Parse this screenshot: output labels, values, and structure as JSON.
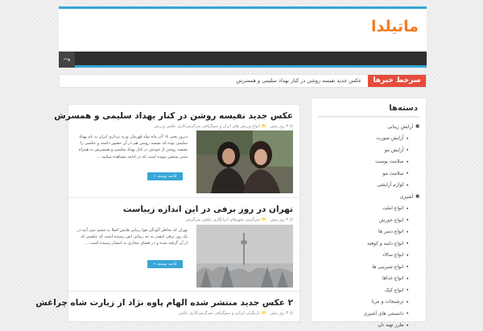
{
  "header": {
    "logo_main": "ماتیلدا",
    "shuffle_icon": "shuffle-icon"
  },
  "breaking": {
    "label": "سرخط خبرها",
    "text": "عکس جدید نفیسه روشن در کنار بهداد سلیمی و همسرش"
  },
  "sidebar": {
    "title": "دسته‌ها",
    "items": [
      {
        "label": "آرایش زیبایی",
        "sub": false
      },
      {
        "label": "آرایش صورت",
        "sub": true
      },
      {
        "label": "آرایش مو",
        "sub": true
      },
      {
        "label": "سلامت پوست",
        "sub": true
      },
      {
        "label": "سلامت مو",
        "sub": true
      },
      {
        "label": "لوازم آرایشی",
        "sub": true
      },
      {
        "label": "آشپزی",
        "sub": false
      },
      {
        "label": "انواع املت",
        "sub": true
      },
      {
        "label": "انواع خورش",
        "sub": true
      },
      {
        "label": "انواع دسر ها",
        "sub": true
      },
      {
        "label": "انواع دلمه و کوفته",
        "sub": true
      },
      {
        "label": "انواع سالاد",
        "sub": true
      },
      {
        "label": "انواع شیرینی ها",
        "sub": true
      },
      {
        "label": "انواع غذاها",
        "sub": true
      },
      {
        "label": "انواع کیک",
        "sub": true
      },
      {
        "label": "ترشیجات و مربا",
        "sub": true
      },
      {
        "label": "دانستنی های آشپزی",
        "sub": true
      },
      {
        "label": "طرز تهیه نان",
        "sub": true
      }
    ]
  },
  "posts": [
    {
      "title": "عکس جدید نفیسه روشن در کنار بهداد سلیمی و همسرش",
      "time": "۳ روز پیش",
      "cats": "انواع ورزش های ایران و سوگرافی سرگرمی‌کاری عکس ورزش",
      "excerpt": "دیروز یعنی ۱۷ آذر ماه تولد قهرمان وزنه برداری ایران به نام بهداد سلیمی بوده که نفیسه روشن هم در آن حضور داشته و عکسی را نفیسه روشن از خودش در کنار بهداد سلیمی و همسرش به همراه متنی منتشر نموده است که در ادامه مشاهده میکنید ...",
      "button": "ادامه نوشته »"
    },
    {
      "title": "تهران در روز برفی در این اندازه زیباست",
      "time": "۳ روز پیش",
      "cats": "سرگرمی شهرهای ایرانگاری عکس سرگرمی",
      "excerpt": "تهران که بخاطر آلودگی هوا زیبایی هایش اصلا به چشم نمی آیند در یک روز برفی اینقدر به حد زیبایی اش رسیده است که عکسی که از آن گرفته شده و در فضای مجازی به انتشار رسیده است ...",
      "button": "ادامه نوشته »"
    },
    {
      "title": "۲ عکس جدید منتشر شده الهام پاوه نژاد از زیارت شاه چراغش",
      "time": "۳ روز پیش",
      "cats": "بازیگران ایرانی و سوگرافی سرگرمی‌کاری عکس"
    }
  ],
  "colors": {
    "accent": "#37a6d6",
    "logo_accent": "#f47c20",
    "breaking": "#e74c3c",
    "nav": "#2f2f2f"
  }
}
